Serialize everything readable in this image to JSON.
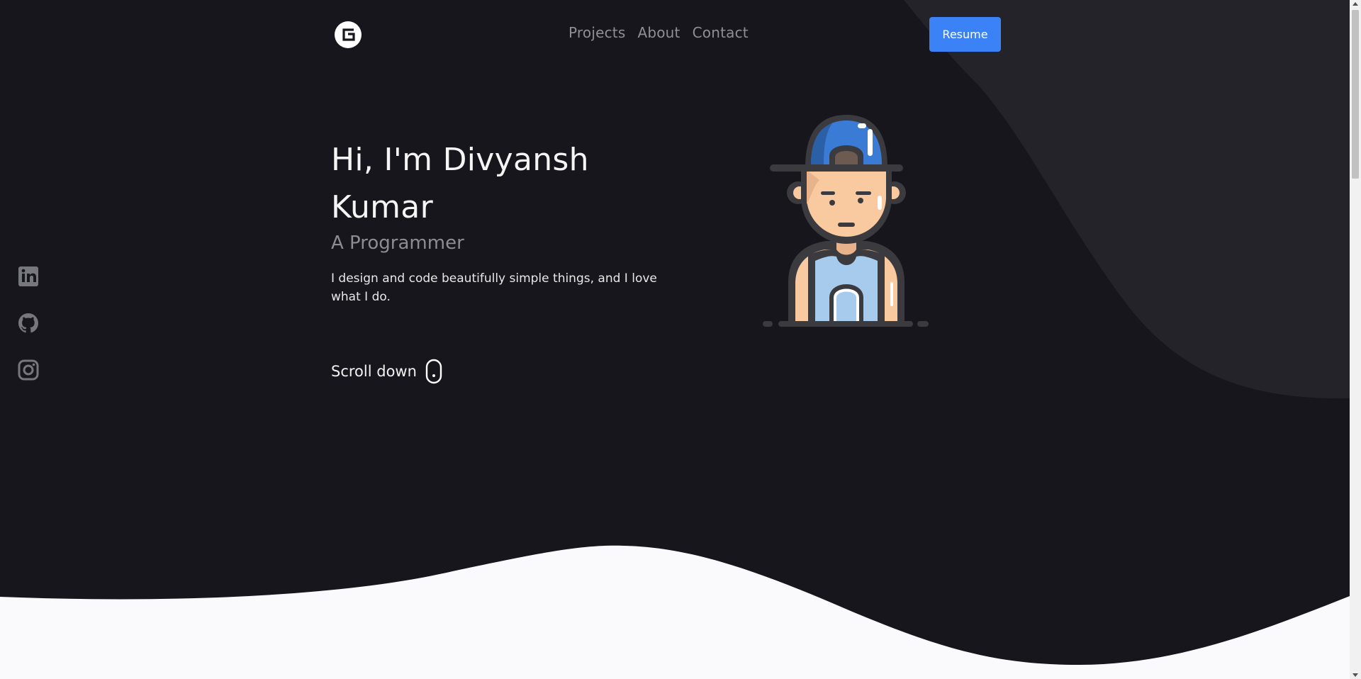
{
  "nav": {
    "links": [
      "Projects",
      "About",
      "Contact"
    ],
    "resume_label": "Resume"
  },
  "hero": {
    "title": "Hi, I'm Divyansh Kumar",
    "subtitle": "A Programmer",
    "description": "I design and code beautifully simple things, and I love what I do.",
    "scroll_label": "Scroll down"
  },
  "social": {
    "icons": [
      "linkedin-icon",
      "github-icon",
      "instagram-icon"
    ]
  },
  "colors": {
    "background": "#17161c",
    "accent_shape": "#24232a",
    "accent": "#3b82f6",
    "muted_text": "#8f8f96",
    "lower_section": "#fafafd"
  }
}
